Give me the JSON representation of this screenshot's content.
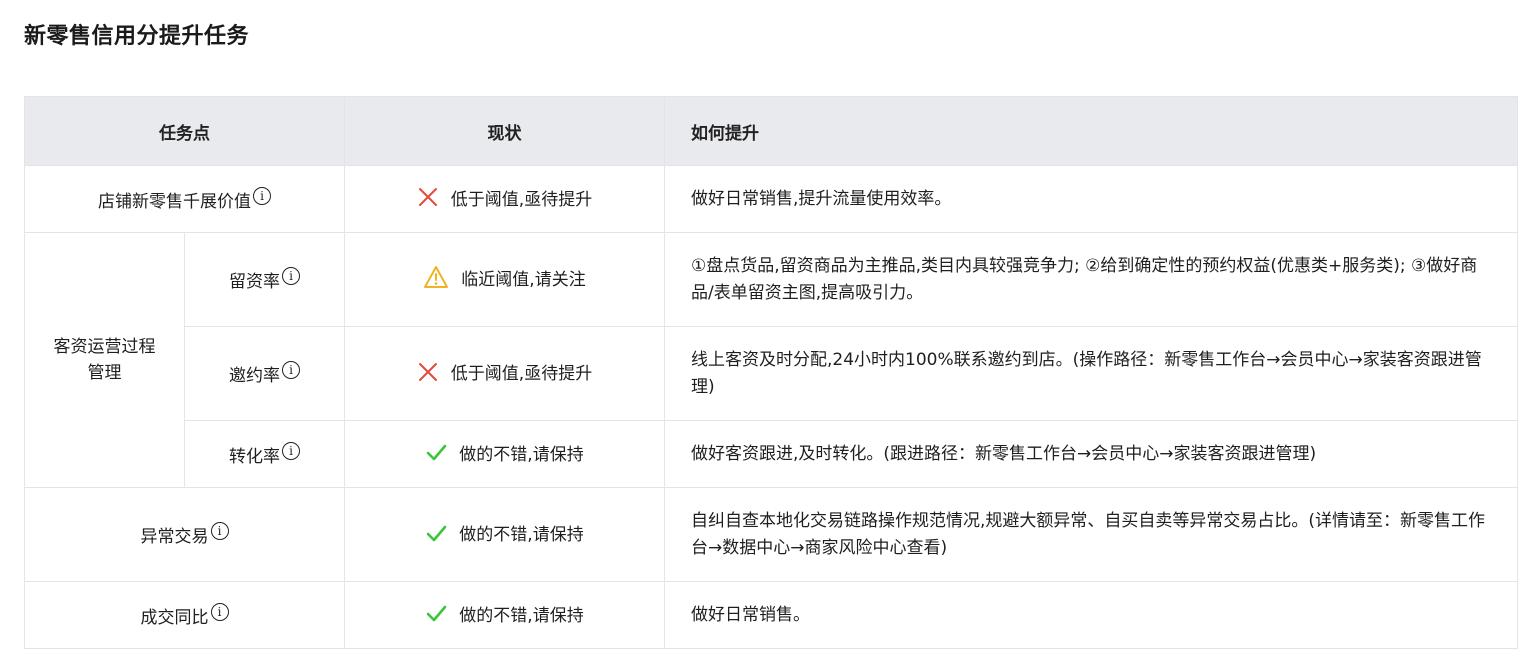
{
  "page_title": "新零售信用分提升任务",
  "headers": [
    "任务点",
    "现状",
    "如何提升"
  ],
  "info_symbol": "i",
  "group": {
    "label": "客资运营过程管理"
  },
  "rows": [
    {
      "task": "店铺新零售千展价值",
      "status_icon": "x-icon",
      "status": "低于阈值,亟待提升",
      "how": "做好日常销售,提升流量使用效率。"
    },
    {
      "task": "留资率",
      "status_icon": "warning-icon",
      "status": "临近阈值,请关注",
      "how": "①盘点货品,留资商品为主推品,类目内具较强竞争力; ②给到确定性的预约权益(优惠类+服务类); ③做好商品/表单留资主图,提高吸引力。"
    },
    {
      "task": "邀约率",
      "status_icon": "x-icon",
      "status": "低于阈值,亟待提升",
      "how": "线上客资及时分配,24小时内100%联系邀约到店。(操作路径：新零售工作台→会员中心→家装客资跟进管理)"
    },
    {
      "task": "转化率",
      "status_icon": "check-icon",
      "status": "做的不错,请保持",
      "how": "做好客资跟进,及时转化。(跟进路径：新零售工作台→会员中心→家装客资跟进管理)"
    },
    {
      "task": "异常交易",
      "status_icon": "check-icon",
      "status": "做的不错,请保持",
      "how": "自纠自查本地化交易链路操作规范情况,规避大额异常、自买自卖等异常交易占比。(详情请至：新零售工作台→数据中心→商家风险中心查看)"
    },
    {
      "task": "成交同比",
      "status_icon": "check-icon",
      "status": "做的不错,请保持",
      "how": "做好日常销售。"
    }
  ],
  "colors": {
    "x": "#e8473c",
    "warning": "#f0b323",
    "check": "#3cc43c",
    "header_bg": "#e9eaee",
    "border": "#e3e3e8"
  }
}
